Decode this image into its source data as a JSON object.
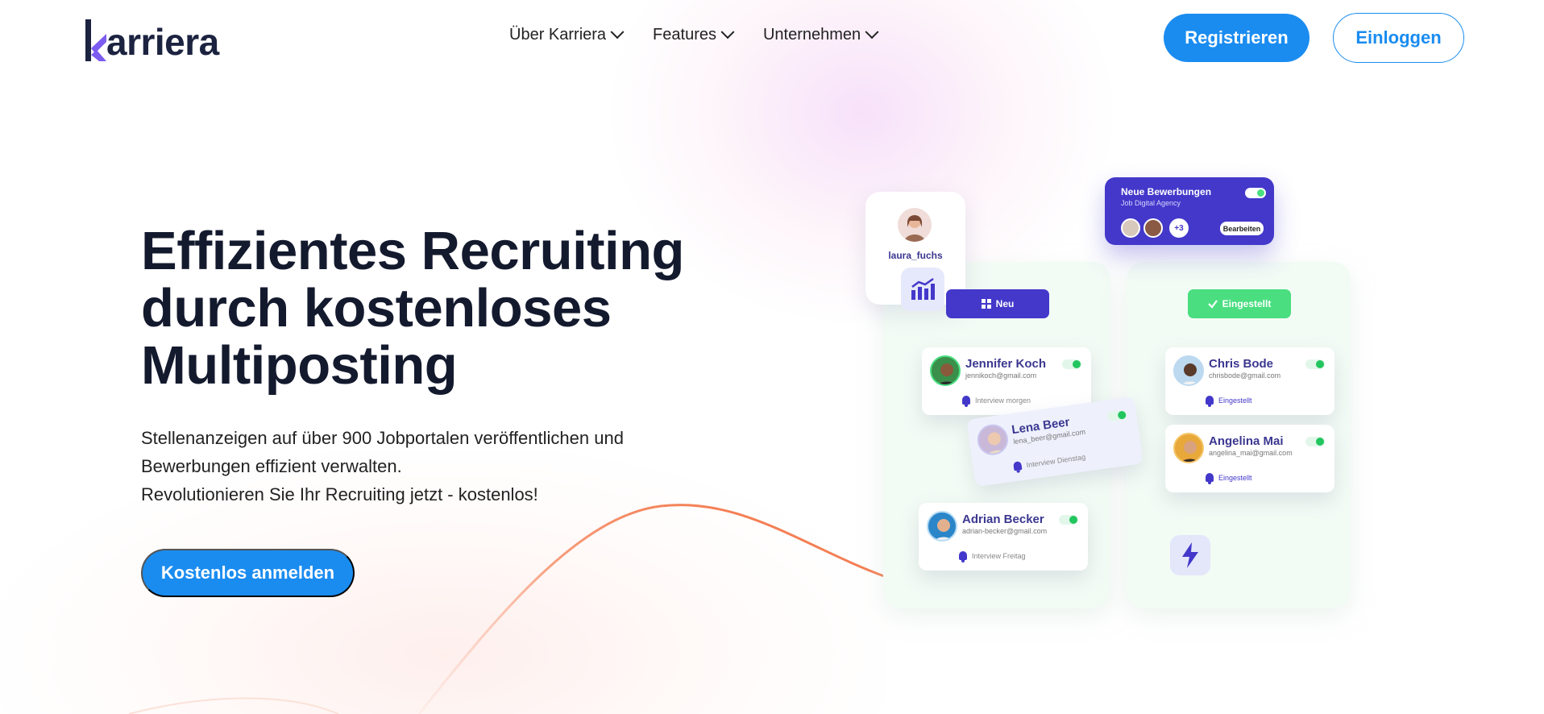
{
  "brand": {
    "name": "arriera",
    "logo_color": "#1c2340",
    "logo_accent": "#7c5cf0"
  },
  "nav": {
    "items": [
      {
        "label": "Über Karriera"
      },
      {
        "label": "Features"
      },
      {
        "label": "Unternehmen"
      }
    ],
    "register_label": "Registrieren",
    "login_label": "Einloggen"
  },
  "hero": {
    "title_lines": [
      "Effizientes Recruiting",
      "durch kostenloses",
      "Multiposting"
    ],
    "subtitle_lines": [
      "Stellenanzeigen auf über 900 Jobportalen veröffentlichen und",
      "Bewerbungen effizient verwalten.",
      "Revolutionieren Sie Ihr Recruiting jetzt - kostenlos!"
    ],
    "cta_label": "Kostenlos anmelden"
  },
  "illustration": {
    "profile": {
      "username": "laura_fuchs"
    },
    "notification": {
      "title": "Neue Bewerbungen",
      "subtitle": "Job Digital Agency",
      "extra_count": "+3",
      "edit_label": "Bearbeiten"
    },
    "columns": {
      "new_label": "Neu",
      "hired_label": "Eingestellt"
    },
    "candidates_new": [
      {
        "name": "Jennifer Koch",
        "email": "jennikoch@gmail.com",
        "status": "Interview morgen"
      },
      {
        "name": "Lena Beer",
        "email": "lena_beer@gmail.com",
        "status": "Interview Dienstag"
      },
      {
        "name": "Adrian Becker",
        "email": "adrian-becker@gmail.com",
        "status": "Interview Freitag"
      }
    ],
    "candidates_hired": [
      {
        "name": "Chris Bode",
        "email": "chrisbode@gmail.com",
        "status": "Eingestellt"
      },
      {
        "name": "Angelina Mai",
        "email": "angelina_mai@gmail.com",
        "status": "Eingestellt"
      }
    ]
  },
  "colors": {
    "primary": "#1a8cf0",
    "indigo": "#4338ca",
    "green": "#4ade80",
    "curve": "#f6835a"
  }
}
